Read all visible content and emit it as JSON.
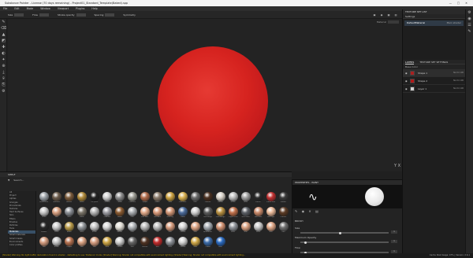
{
  "app": {
    "title": "Substance Painter - License (70 days remaining) - Project01_Standard_Template(Baked).spp",
    "window_controls": [
      "—",
      "□",
      "✕"
    ]
  },
  "menu": [
    "File",
    "Edit",
    "Mode",
    "Window",
    "Viewport",
    "Plugins",
    "Help"
  ],
  "toolbar": {
    "size_label": "Size",
    "flow_label": "Flow",
    "stroke_opacity_label": "Stroke opacity",
    "spacing_label": "Spacing",
    "symmetry_label": "Symmetry",
    "material_label": "Material"
  },
  "left_tools": [
    "✎",
    "⌫",
    "▲",
    "◩",
    "✚",
    "◐",
    "✦",
    "⊕",
    "⤓",
    "⌾",
    "⎘",
    "⚙"
  ],
  "right_strip": [
    "⚙",
    "◉",
    "☰",
    "✎"
  ],
  "viewport": {
    "view_mode": "Material",
    "gizmo": "Y X"
  },
  "texture_set_list": {
    "title": "TEXTURE SET LIST",
    "settings": "Settings",
    "row_name": "DefaultMaterial",
    "row_shader": "Main shader"
  },
  "layers": {
    "tabs": [
      "LAYERS",
      "TEXTURE SET SETTINGS"
    ],
    "base_color": "Base Color",
    "items": [
      {
        "name": "Shape 1",
        "blend": "Norm",
        "opacity": "100",
        "thumb": "#a82020"
      },
      {
        "name": "Shape 2",
        "blend": "Norm",
        "opacity": "100",
        "thumb": "#b01818"
      },
      {
        "name": "Layer 1",
        "blend": "Norm",
        "opacity": "100",
        "thumb": "#d0d0d0"
      }
    ]
  },
  "shelf": {
    "title": "SHELF",
    "tools_label": "Search...",
    "categories": [
      "All",
      "Project",
      "Alphas",
      "Grunges",
      "Procedurals",
      "Textures",
      "Hard Surfaces",
      "Skin",
      "Filters",
      "Brushes",
      "Particles",
      "Tools",
      "Materials",
      "Smart materials",
      "Smart masks",
      "Environments",
      "Color profiles"
    ],
    "selected_category": "Materials",
    "materials": [
      {
        "name": "Aluminium",
        "color": "#9aa0a6"
      },
      {
        "name": "Artificial",
        "color": "#6a5a4a"
      },
      {
        "name": "Bronze",
        "color": "#7a5a3a"
      },
      {
        "name": "Brass",
        "color": "#b08a3a"
      },
      {
        "name": "Car paint",
        "color": "#222222"
      },
      {
        "name": "Chrome",
        "color": "#cfcfcf"
      },
      {
        "name": "Cobalt",
        "color": "#8a8a8a"
      },
      {
        "name": "Concrete",
        "color": "#9a9a92"
      },
      {
        "name": "Copper",
        "color": "#b06a4a"
      },
      {
        "name": "Fabric",
        "color": "#8a7a6a"
      },
      {
        "name": "Gold",
        "color": "#caa040"
      },
      {
        "name": "Gold Pure",
        "color": "#d8b050"
      },
      {
        "name": "Iron",
        "color": "#6a6a6a"
      },
      {
        "name": "Leather",
        "color": "#4a3020"
      },
      {
        "name": "Marble",
        "color": "#d8d2c8"
      },
      {
        "name": "Nickel",
        "color": "#bcbcbc"
      },
      {
        "name": "Paint",
        "color": "#a0a0a0"
      },
      {
        "name": "Plastic",
        "color": "#2a2a2a"
      },
      {
        "name": "Plastic Red",
        "color": "#c03030"
      },
      {
        "name": "Rubber",
        "color": "#3a3a3a"
      },
      {
        "name": "Silver",
        "color": "#c8c8c8"
      },
      {
        "name": "Skin",
        "color": "#d8a080"
      },
      {
        "name": "Steel",
        "color": "#8a8e94"
      },
      {
        "name": "Stone",
        "color": "#7a7468"
      },
      {
        "name": "Tin",
        "color": "#b4b4b4"
      },
      {
        "name": "Titanium",
        "color": "#9a9aa0"
      },
      {
        "name": "Wood",
        "color": "#8a5a30"
      },
      {
        "name": "Zinc",
        "color": "#a8acb0"
      },
      {
        "name": "Skin Face",
        "color": "#e0a888"
      },
      {
        "name": "Skin Arm",
        "color": "#d89878"
      },
      {
        "name": "Skin Leg",
        "color": "#d29676"
      },
      {
        "name": "Cobalt",
        "color": "#4a6a9a"
      },
      {
        "name": "Chrome",
        "color": "#d0d0d0"
      },
      {
        "name": "Iron Rough",
        "color": "#5a5a5a"
      },
      {
        "name": "Gold Rough",
        "color": "#b89040"
      },
      {
        "name": "Copper Pure",
        "color": "#c0704a"
      },
      {
        "name": "Steel Dark",
        "color": "#5a5e64"
      },
      {
        "name": "Skin Dark",
        "color": "#c88868"
      },
      {
        "name": "Skin Light",
        "color": "#e8b898"
      },
      {
        "name": "Leather",
        "color": "#5a3a24"
      },
      {
        "name": "Rubber",
        "color": "#282828"
      },
      {
        "name": "Silver",
        "color": "#cacaca"
      },
      {
        "name": "Brass",
        "color": "#b89a48"
      },
      {
        "name": "Steel",
        "color": "#909498"
      },
      {
        "name": "Nickel",
        "color": "#c4c4c4"
      },
      {
        "name": "Plastic",
        "color": "#d6d6d6"
      },
      {
        "name": "Marble",
        "color": "#e0dcd4"
      },
      {
        "name": "Zinc",
        "color": "#b0b4b8"
      },
      {
        "name": "Paint",
        "color": "#b8b8b8"
      },
      {
        "name": "Tin",
        "color": "#bababa"
      },
      {
        "name": "Skin",
        "color": "#d49a7c"
      },
      {
        "name": "Chrome",
        "color": "#d4d4d4"
      },
      {
        "name": "Skin",
        "color": "#dca484"
      },
      {
        "name": "Aluminium",
        "color": "#a2a8ae"
      },
      {
        "name": "Skin",
        "color": "#d09070"
      },
      {
        "name": "Steel",
        "color": "#8e9298"
      },
      {
        "name": "Skin",
        "color": "#d8a080"
      },
      {
        "name": "Silver",
        "color": "#c6c6c6"
      },
      {
        "name": "Skin",
        "color": "#dea686"
      },
      {
        "name": "Iron",
        "color": "#6e6e6e"
      },
      {
        "name": "Skin",
        "color": "#d49c7e"
      },
      {
        "name": "Nickel",
        "color": "#c2c2c2"
      },
      {
        "name": "Copper",
        "color": "#b4704e"
      },
      {
        "name": "Skin",
        "color": "#daa282"
      },
      {
        "name": "Skin",
        "color": "#d69e80"
      },
      {
        "name": "Gold",
        "color": "#cca444"
      },
      {
        "name": "Chrome",
        "color": "#cccccc"
      },
      {
        "name": "Iron",
        "color": "#646464"
      },
      {
        "name": "Leather",
        "color": "#4e3222"
      },
      {
        "name": "Red",
        "color": "#c02a2a"
      },
      {
        "name": "Steel",
        "color": "#8c9096"
      },
      {
        "name": "Chrome",
        "color": "#d2d2d2"
      },
      {
        "name": "Gold",
        "color": "#d0a848"
      },
      {
        "name": "Cobalt",
        "color": "#3a6aa8"
      },
      {
        "name": "Blue",
        "color": "#2a6ac0"
      }
    ]
  },
  "properties": {
    "title": "PROPERTIES - PAINT",
    "tools": [
      "✎",
      "◉",
      "✕",
      "▤"
    ],
    "section_brush": "BRUSH",
    "size_label": "Size",
    "size_value": "1",
    "size_fraction": 0.45,
    "spacing_label": "Maximum Opacity",
    "spacing_value": "1",
    "spacing_fraction": 0.05,
    "flow_label": "Flow",
    "flow_value": "1",
    "flow_fraction": 0.05
  },
  "status": {
    "message": "[Shader] Warning: No light buffer declaration found in shader - defaulting to use 'Distance' mode. [Shader] Warning: Shader not compatible with environment lighting. [Shader] Warning: Shader not compatible with environment lighting...",
    "cache": "Cache Disk Usage: 47% | Version: 2.6.1"
  }
}
